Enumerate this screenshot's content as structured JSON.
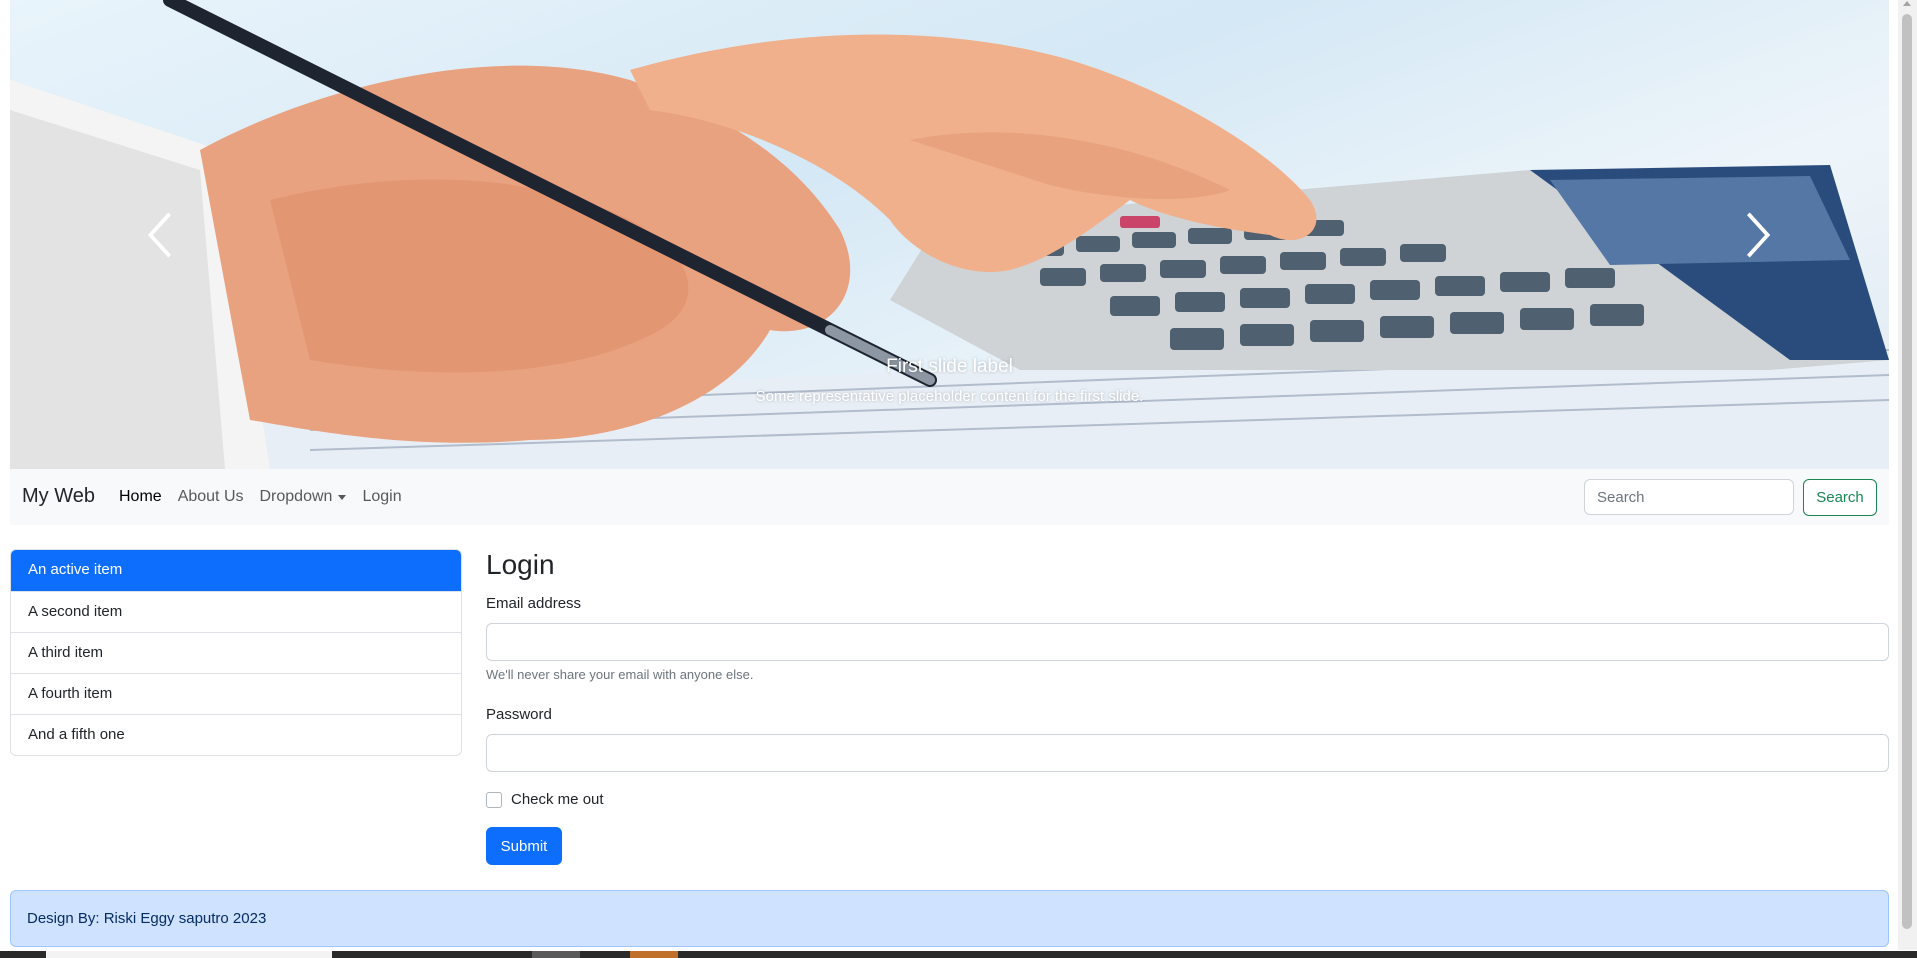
{
  "carousel": {
    "prev_icon": "chevron-left-icon",
    "next_icon": "chevron-right-icon",
    "caption_title": "First slide label",
    "caption_text": "Some representative placeholder content for the first slide."
  },
  "navbar": {
    "brand": "My Web",
    "links": [
      {
        "label": "Home",
        "active": true
      },
      {
        "label": "About Us"
      },
      {
        "label": "Dropdown",
        "has_caret": true
      },
      {
        "label": "Login"
      }
    ],
    "search_placeholder": "Search",
    "search_button": "Search"
  },
  "list_group": {
    "items": [
      "An active item",
      "A second item",
      "A third item",
      "A fourth item",
      "And a fifth one"
    ],
    "active_index": 0
  },
  "login": {
    "title": "Login",
    "email_label": "Email address",
    "email_help": "We'll never share your email with anyone else.",
    "password_label": "Password",
    "check_label": "Check me out",
    "submit": "Submit"
  },
  "footer": {
    "text": "Design By: Riski Eggy saputro 2023"
  },
  "colors": {
    "primary": "#0d6efd",
    "success_outline": "#198754",
    "navbar_bg": "#f8f9fa",
    "footer_bg": "#cfe2ff"
  }
}
